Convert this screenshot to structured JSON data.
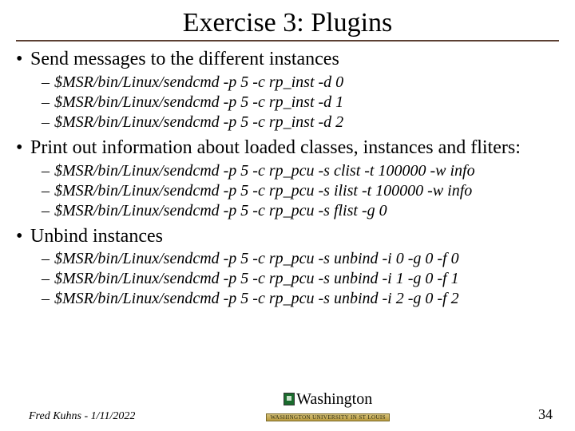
{
  "title": "Exercise 3: Plugins",
  "b1": {
    "text": "Send messages to the different instances",
    "cmds": [
      "$MSR/bin/Linux/sendcmd -p 5 -c rp_inst -d 0",
      "$MSR/bin/Linux/sendcmd -p 5 -c rp_inst -d 1",
      "$MSR/bin/Linux/sendcmd -p 5 -c rp_inst -d 2"
    ]
  },
  "b2": {
    "text": "Print out information about loaded classes, instances and fliters:",
    "cmds": [
      "$MSR/bin/Linux/sendcmd -p 5 -c rp_pcu -s clist -t 100000 -w info",
      "$MSR/bin/Linux/sendcmd -p 5 -c rp_pcu -s ilist -t 100000 -w info",
      "$MSR/bin/Linux/sendcmd -p 5 -c rp_pcu -s flist -g 0"
    ]
  },
  "b3": {
    "text": "Unbind instances",
    "cmds": [
      "$MSR/bin/Linux/sendcmd -p 5 -c rp_pcu -s unbind -i 0 -g 0 -f 0",
      "$MSR/bin/Linux/sendcmd -p 5 -c rp_pcu -s unbind -i 1 -g 0 -f 1",
      "$MSR/bin/Linux/sendcmd -p 5 -c rp_pcu -s unbind -i 2 -g 0 -f 2"
    ]
  },
  "footer": {
    "left": "Fred Kuhns - 1/11/2022",
    "university": "Washington",
    "university_sub": "WASHINGTON UNIVERSITY IN ST LOUIS",
    "page": "34"
  }
}
